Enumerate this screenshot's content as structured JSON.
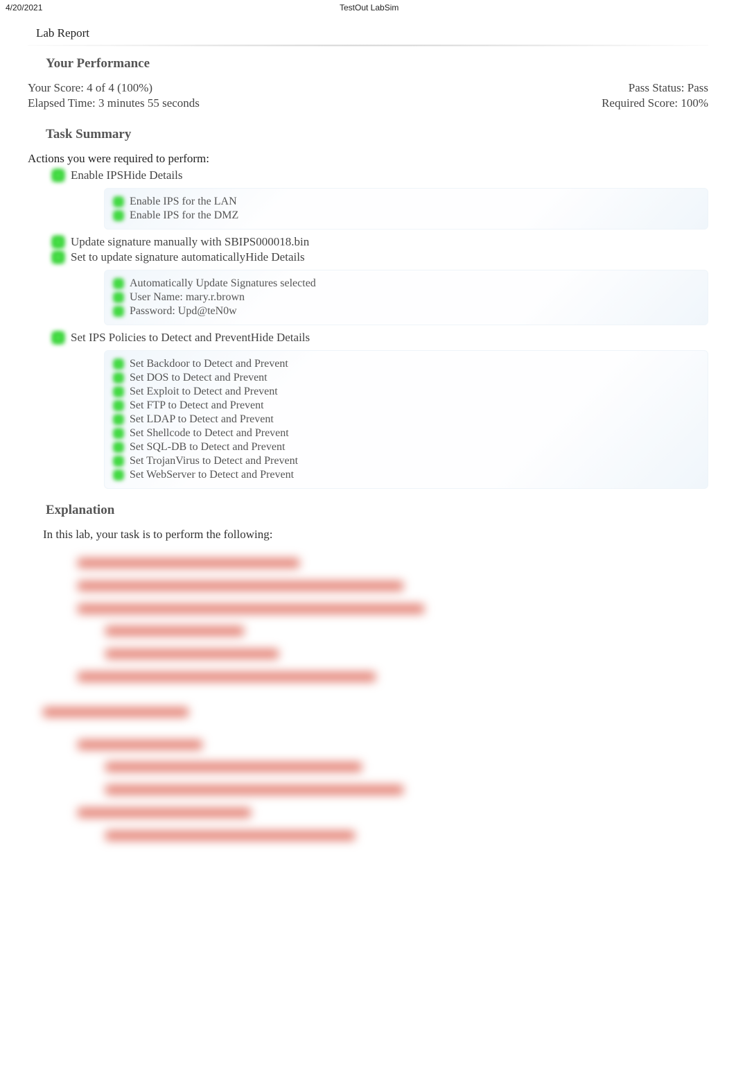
{
  "header": {
    "date": "4/20/2021",
    "app_title": "TestOut LabSim"
  },
  "lab_title": "Lab Report",
  "sections": {
    "performance_h": "Your Performance",
    "score_line": "Your Score: 4 of 4 (100%)",
    "time_line": "Elapsed Time: 3 minutes 55 seconds",
    "pass_status": "Pass Status: Pass",
    "req_score": "Required Score: 100%",
    "task_summary_h": "Task Summary",
    "actions_h": "Actions you were required to perform:",
    "explanation_h": "Explanation",
    "explanation_intro": "In this lab, your task is to perform the following:"
  },
  "tasks": [
    {
      "label": "Enable IPS",
      "toggle": "Hide Details",
      "subs": [
        "Enable IPS for the LAN",
        "Enable IPS for the DMZ"
      ]
    },
    {
      "label": "Update signature manually with SBIPS000018.bin",
      "toggle": "",
      "subs": []
    },
    {
      "label": "Set to update signature automatically",
      "toggle": "Hide Details",
      "subs": [
        "Automatically Update Signatures selected",
        "User Name: mary.r.brown",
        "Password: Upd@teN0w"
      ]
    },
    {
      "label": "Set IPS Policies to Detect and Prevent",
      "toggle": "Hide Details",
      "subs": [
        "Set Backdoor to Detect and Prevent",
        "Set DOS to Detect and Prevent",
        "Set Exploit to Detect and Prevent",
        "Set FTP to Detect and Prevent",
        "Set LDAP to Detect and Prevent",
        "Set Shellcode to Detect and Prevent",
        "Set SQL-DB to Detect and Prevent",
        "Set TrojanVirus to Detect and Prevent",
        "Set WebServer to Detect and Prevent"
      ]
    }
  ]
}
